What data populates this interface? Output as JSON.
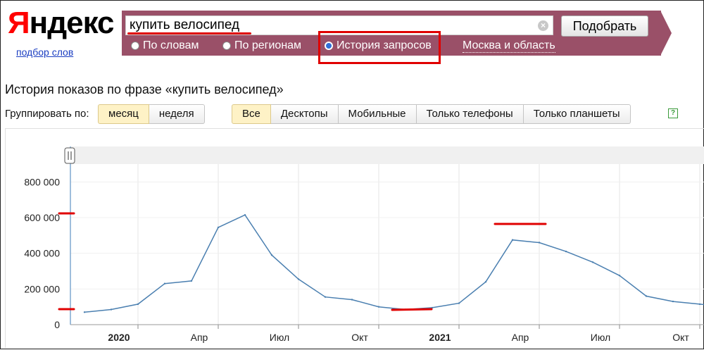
{
  "logo": {
    "first": "Я",
    "rest": "ндекс"
  },
  "wordstat_link": "подбор слов",
  "search": {
    "value": "купить велосипед",
    "button": "Подобрать"
  },
  "radios": [
    {
      "label": "По словам",
      "checked": false
    },
    {
      "label": "По регионам",
      "checked": false
    },
    {
      "label": "История запросов",
      "checked": true
    }
  ],
  "region": "Москва и область",
  "page_title": "История показов по фразе «купить велосипед»",
  "group_label": "Группировать по:",
  "group_options": [
    {
      "label": "месяц",
      "active": true
    },
    {
      "label": "неделя",
      "active": false
    }
  ],
  "device_options": [
    {
      "label": "Все",
      "active": true
    },
    {
      "label": "Десктопы",
      "active": false
    },
    {
      "label": "Мобильные",
      "active": false
    },
    {
      "label": "Только телефоны",
      "active": false
    },
    {
      "label": "Только планшеты",
      "active": false
    }
  ],
  "help": "?",
  "colors": {
    "band": "#9a5068",
    "line": "#4a7fb0",
    "annotation": "#e00000"
  },
  "chart_data": {
    "type": "line",
    "x": [
      "2019-11",
      "2019-12",
      "2020-01",
      "2020-02",
      "2020-03",
      "2020-04",
      "2020-05",
      "2020-06",
      "2020-07",
      "2020-08",
      "2020-09",
      "2020-10",
      "2020-11",
      "2020-12",
      "2021-01",
      "2021-02",
      "2021-03",
      "2021-04",
      "2021-05",
      "2021-06",
      "2021-07",
      "2021-08",
      "2021-09",
      "2021-10",
      "2021-11"
    ],
    "series": [
      {
        "values": [
          70000,
          85000,
          115000,
          230000,
          245000,
          545000,
          615000,
          390000,
          255000,
          155000,
          140000,
          100000,
          85000,
          95000,
          120000,
          240000,
          475000,
          460000,
          410000,
          350000,
          275000,
          160000,
          130000,
          115000,
          100000
        ]
      }
    ],
    "ylim": [
      0,
      900000
    ],
    "yticks": [
      {
        "v": 0,
        "label": "0"
      },
      {
        "v": 200000,
        "label": "200 000"
      },
      {
        "v": 400000,
        "label": "400 000"
      },
      {
        "v": 600000,
        "label": "600 000"
      },
      {
        "v": 800000,
        "label": "800 000"
      }
    ],
    "xticks": [
      {
        "i": 2,
        "label": "2020",
        "bold": true
      },
      {
        "i": 5,
        "label": "Апр",
        "bold": false
      },
      {
        "i": 8,
        "label": "Июл",
        "bold": false
      },
      {
        "i": 11,
        "label": "Окт",
        "bold": false
      },
      {
        "i": 14,
        "label": "2021",
        "bold": true
      },
      {
        "i": 17,
        "label": "Апр",
        "bold": false
      },
      {
        "i": 20,
        "label": "Июл",
        "bold": false
      },
      {
        "i": 23,
        "label": "Окт",
        "bold": false
      }
    ],
    "grid": true
  }
}
